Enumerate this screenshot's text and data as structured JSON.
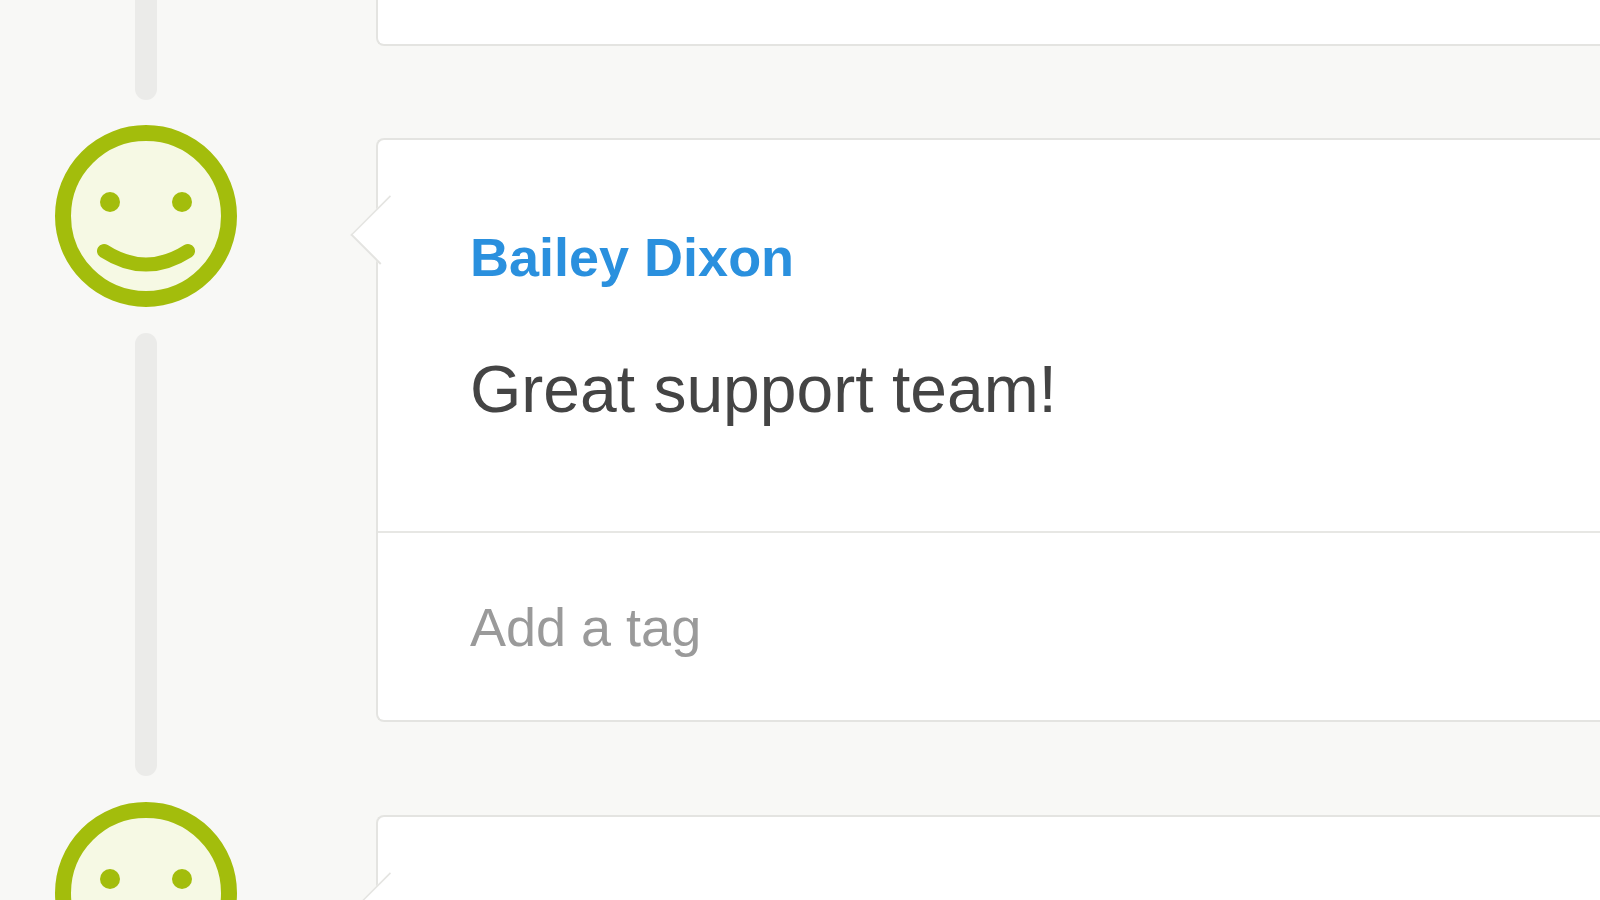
{
  "entries": [
    {
      "kind": "happy",
      "author": "Bailey Dixon",
      "comment": "Great support team!",
      "tag_field": {
        "placeholder": "Add a tag"
      }
    },
    {
      "kind": "happy"
    }
  ]
}
